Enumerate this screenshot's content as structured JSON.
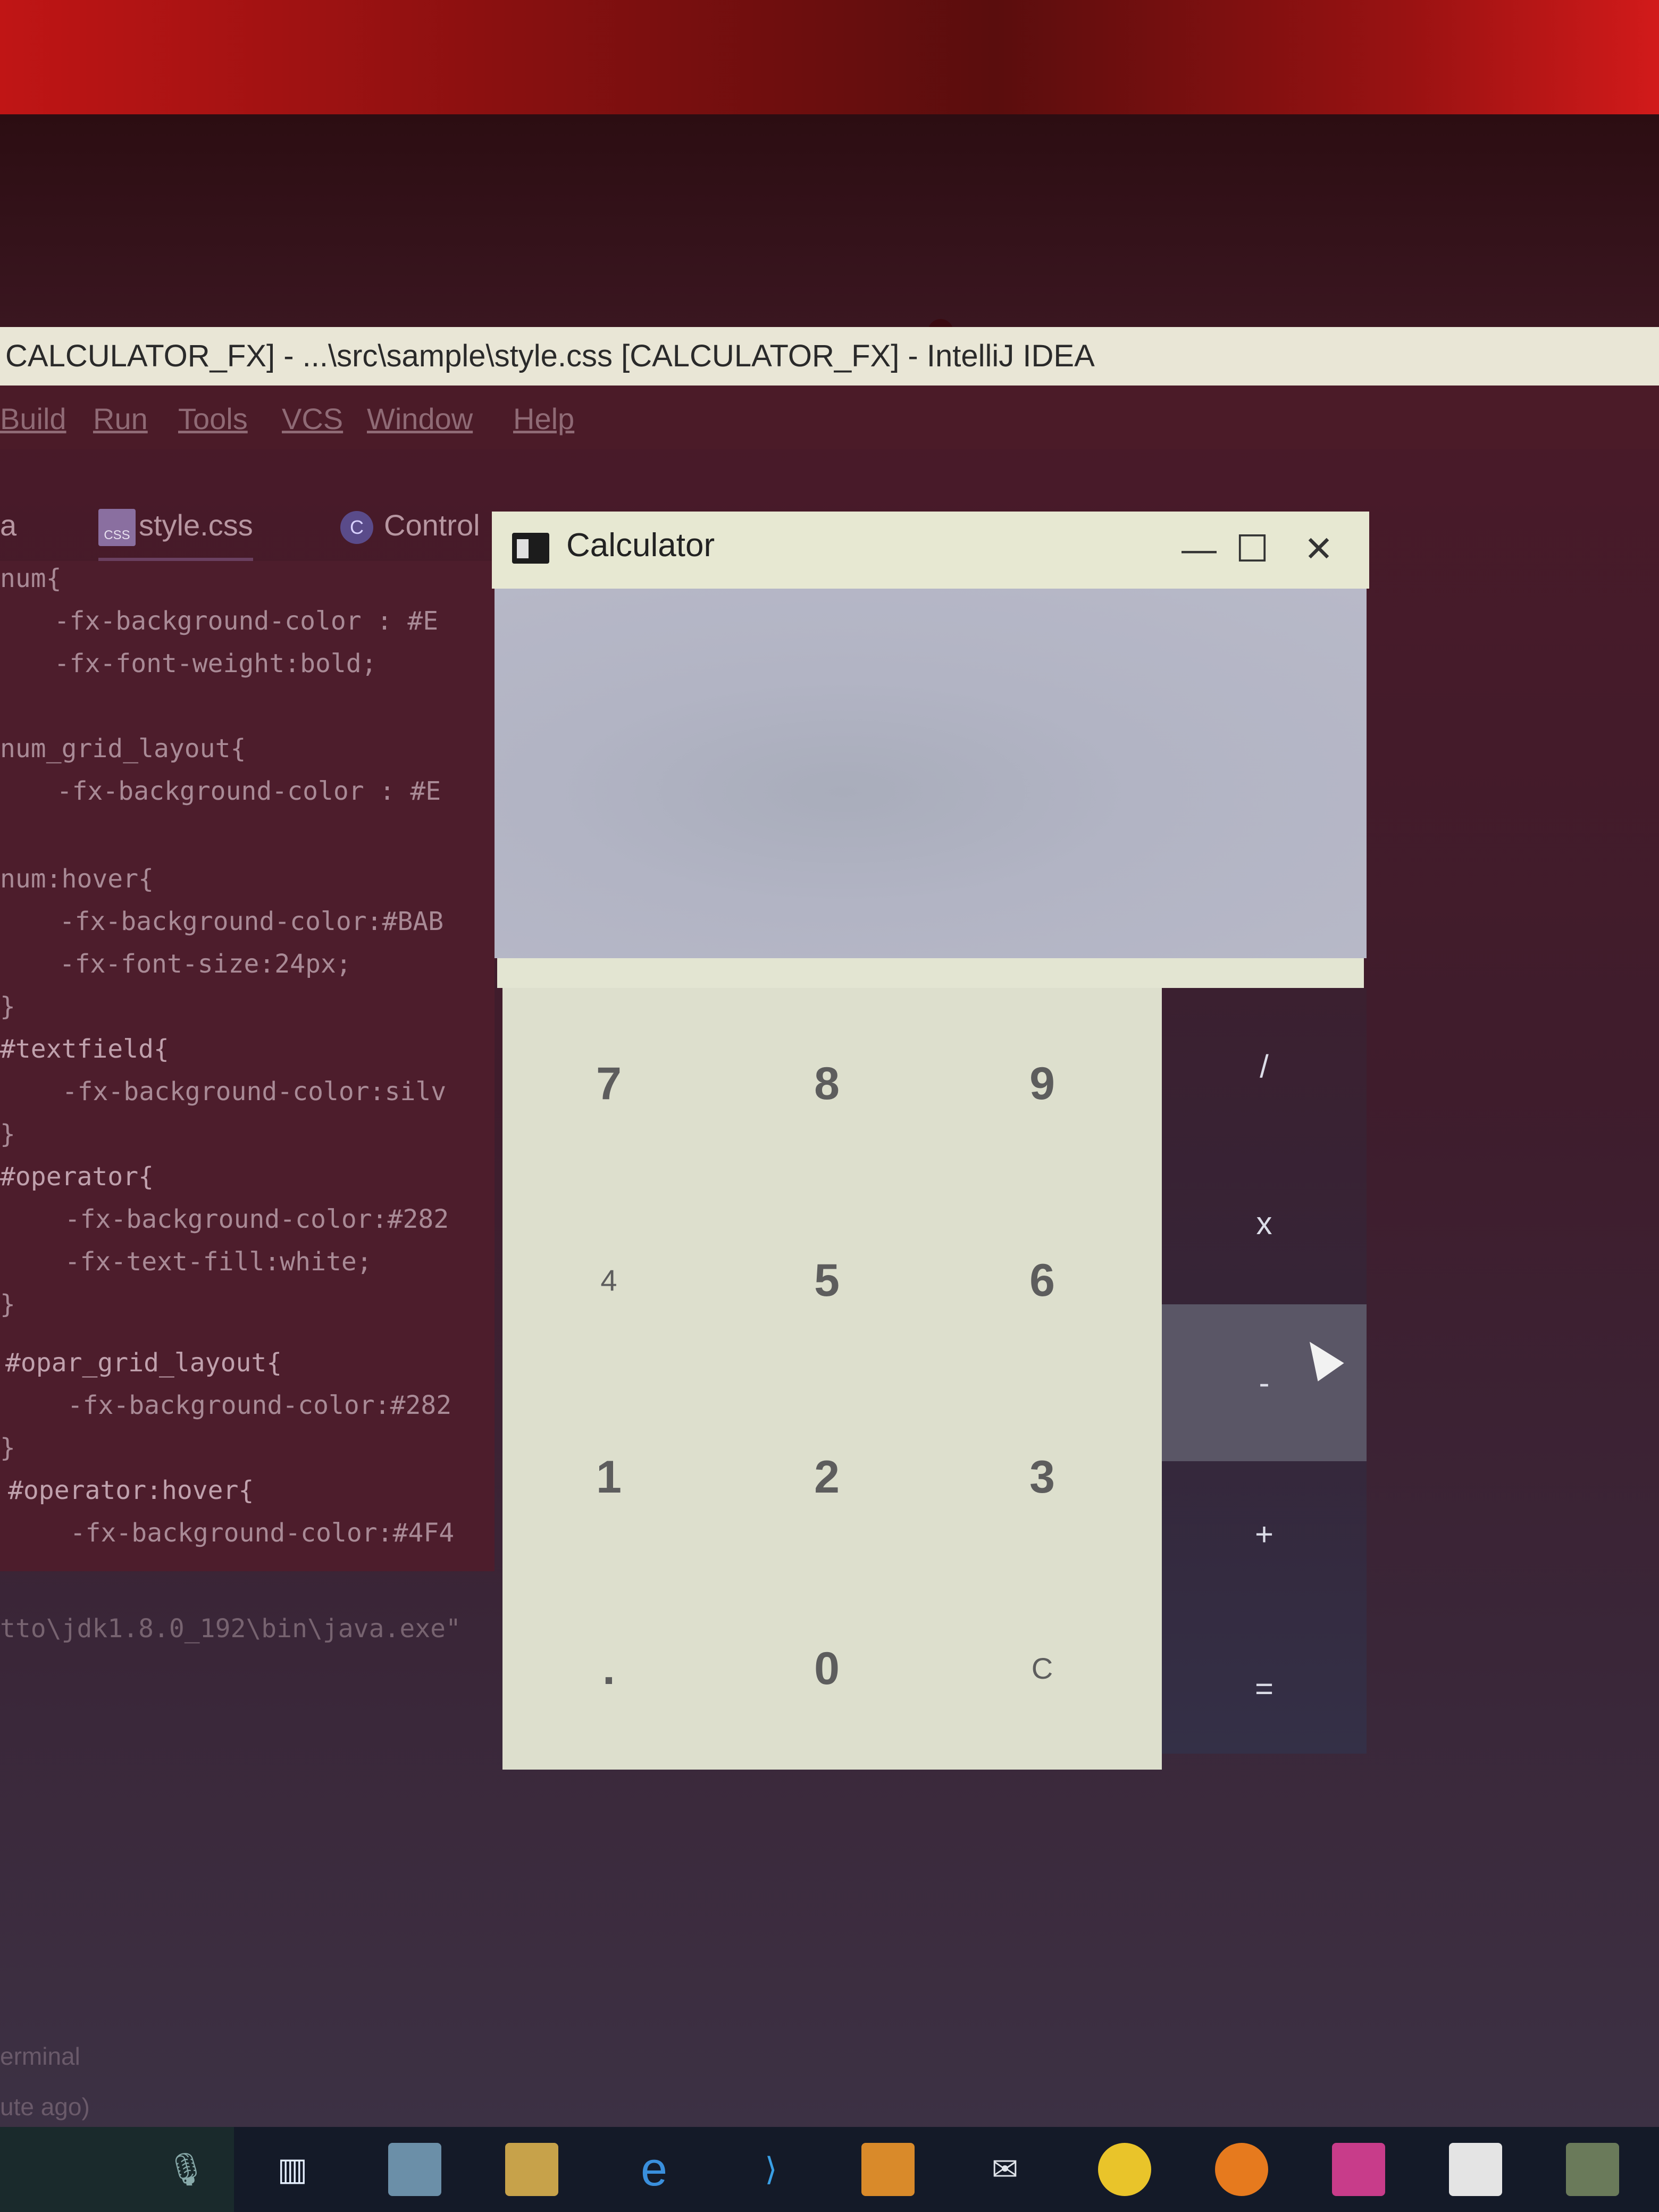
{
  "ide": {
    "title": "CALCULATOR_FX] - ...\\src\\sample\\style.css [CALCULATOR_FX] - IntelliJ IDEA",
    "menu": [
      "Build",
      "Run",
      "Tools",
      "VCS",
      "Window",
      "Help"
    ],
    "tabs": {
      "partial": "a",
      "style": "style.css",
      "control": "Control"
    },
    "code": [
      "num{",
      "   -fx-background-color : #E",
      "   -fx-font-weight:bold;",
      "",
      "num_grid_layout{",
      "   -fx-background-color : #E",
      "",
      "num:hover{",
      "   -fx-background-color:#BAB",
      "   -fx-font-size:24px;",
      "}",
      "#textfield{",
      "   -fx-background-color:silv",
      "}",
      "#operator{",
      "   -fx-background-color:#282",
      "   -fx-text-fill:white;",
      "}",
      "#opar_grid_layout{",
      "   -fx-background-color:#282",
      "}",
      "#operator:hover{",
      "   -fx-background-color:#4F4"
    ],
    "run_line": "tto\\jdk1.8.0_192\\bin\\java.exe\"",
    "bottom": {
      "terminal": "erminal",
      "ago": "ute ago)"
    }
  },
  "calculator": {
    "title": "Calculator",
    "window_buttons": {
      "minimize": "—",
      "maximize": "☐",
      "close": "✕"
    },
    "display_value": "",
    "numbers": [
      "7",
      "8",
      "9",
      "4",
      "5",
      "6",
      "1",
      "2",
      "3",
      ".",
      "0",
      "C"
    ],
    "operators": [
      "/",
      "x",
      "-",
      "+",
      "="
    ],
    "hovered_operator": "-"
  },
  "taskbar": {
    "icons": [
      "microphone-icon",
      "task-view-icon",
      "folder-icon",
      "file-explorer-icon",
      "edge-icon",
      "vscode-icon",
      "store-icon",
      "mail-icon",
      "chrome-icon",
      "firefox-icon",
      "intellij-icon",
      "media-icon",
      "app-icon"
    ]
  }
}
